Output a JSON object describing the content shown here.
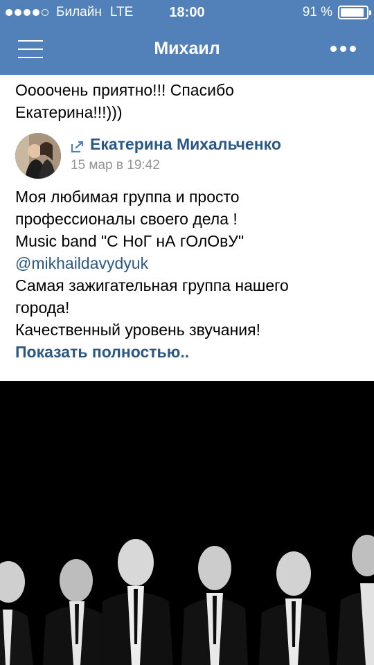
{
  "status": {
    "carrier": "Билайн",
    "network": "LTE",
    "time": "18:00",
    "battery": "91 %",
    "battery_level": 0.91
  },
  "nav": {
    "title": "Михаил",
    "menu_icon": "hamburger-menu-icon",
    "more_icon": "more-dots-icon"
  },
  "comment": {
    "line1": "Оооочень приятно!!! Спасибо",
    "line2": "Екатерина!!!)))"
  },
  "repost": {
    "author": "Екатерина Михальченко",
    "date": "15 мар в 19:42",
    "icon": "repost-icon"
  },
  "post": {
    "lines": [
      "Моя любимая группа и просто",
      "профессионалы своего дела !",
      "Music band \"С НоГ нА гОлОвУ\"",
      "@mikhaildavydyuk",
      "Самая зажигательная группа нашего",
      "города!",
      "Качественный уровень звучания!"
    ],
    "show_more": "Показать полностью.."
  },
  "colors": {
    "header": "#5181b8",
    "link": "#2a5885",
    "muted": "#939393"
  }
}
